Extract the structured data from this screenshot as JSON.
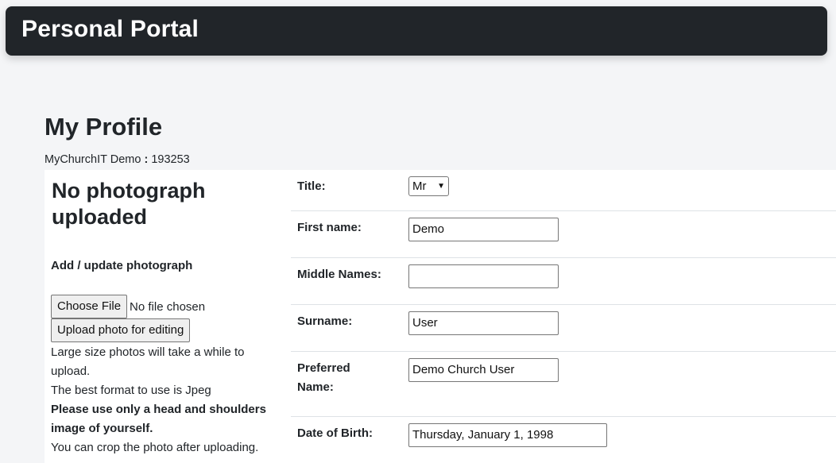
{
  "navbar": {
    "brand": "Personal Portal"
  },
  "page": {
    "title": "My Profile",
    "org_name": "MyChurchIT Demo",
    "org_separator": ":",
    "org_id": "193253"
  },
  "photo": {
    "heading": "No photograph uploaded",
    "add_label": "Add / update photograph",
    "choose_file_label": "Choose File",
    "file_status": "No file chosen",
    "upload_button": "Upload photo for editing",
    "note_large_1": "Large size photos will take a while to",
    "note_large_2": "upload.",
    "note_format": "The best format to use is Jpeg",
    "note_head_1": "Please use only a head and shoulders",
    "note_head_2": "image of yourself.",
    "note_crop": "You can crop the photo after uploading."
  },
  "form": {
    "title_label": "Title:",
    "title_value": "Mr",
    "first_name_label": "First name:",
    "first_name_value": "Demo",
    "middle_names_label": "Middle Names:",
    "middle_names_value": "",
    "surname_label": "Surname:",
    "surname_value": "User",
    "preferred_label_1": "Preferred",
    "preferred_label_2": "Name:",
    "preferred_value": "Demo Church User",
    "dob_label": "Date of Birth:",
    "dob_value": "Thursday, January 1, 1998"
  }
}
